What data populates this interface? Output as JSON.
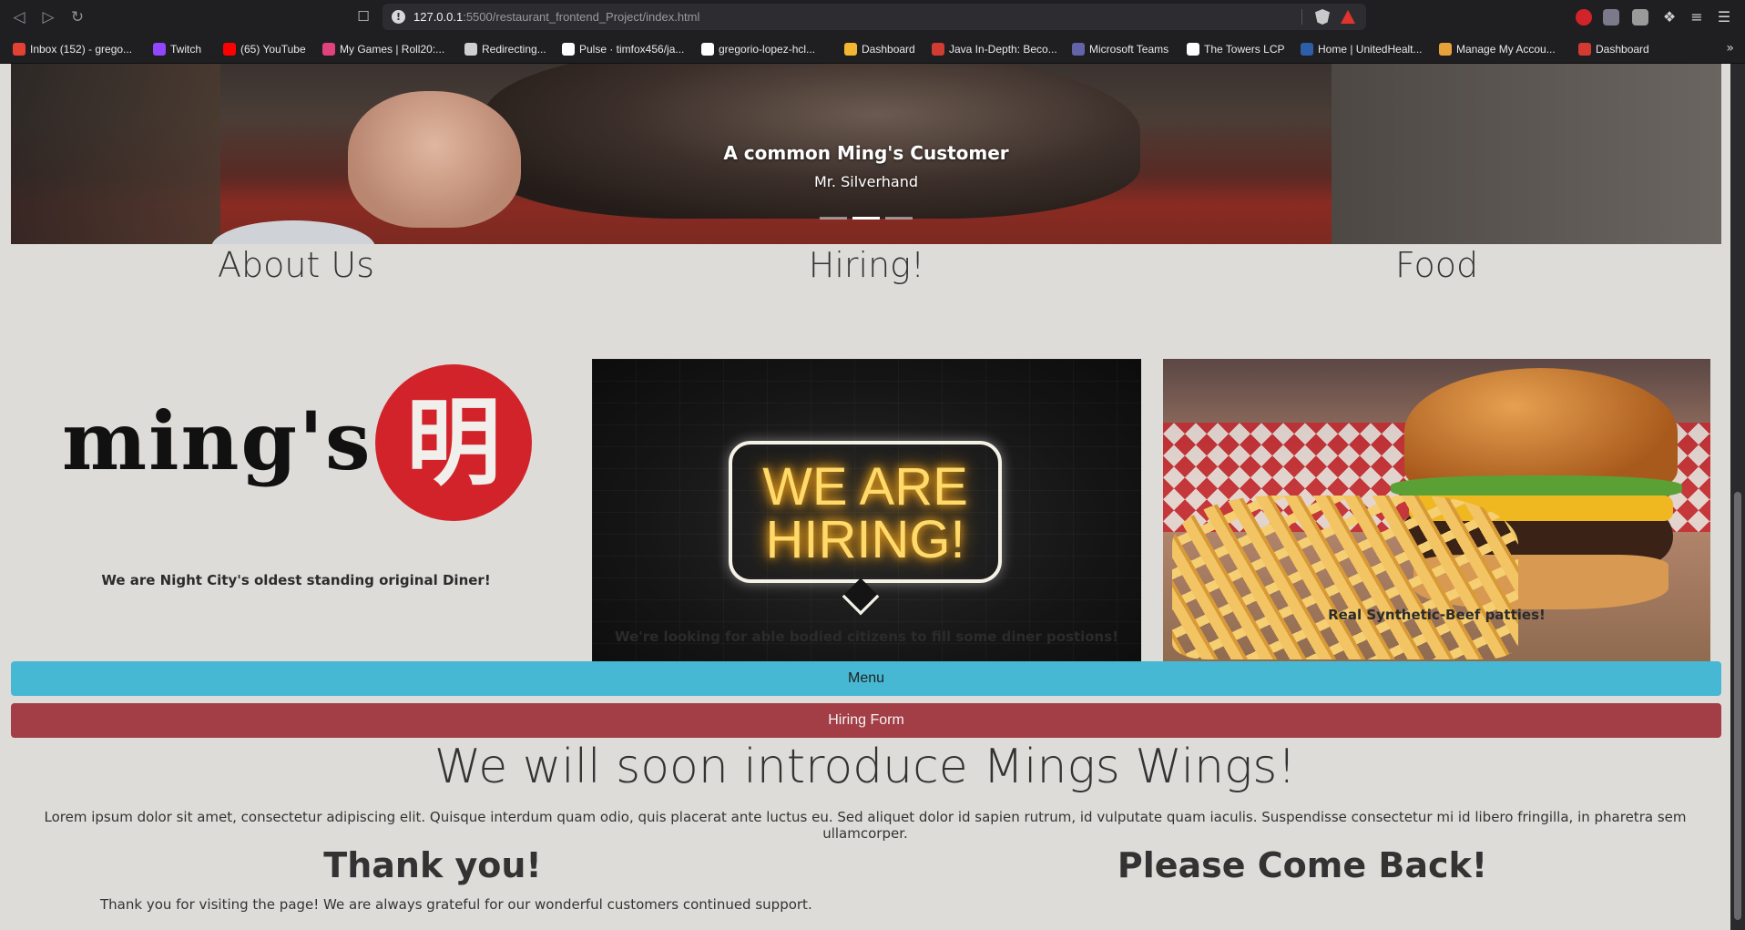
{
  "browser": {
    "url_host": "127.0.0.1",
    "url_rest": ":5500/restaurant_frontend_Project/index.html",
    "bookmarks": [
      {
        "label": "Inbox (152) - grego...",
        "icon_color": "#e34133"
      },
      {
        "label": "Twitch",
        "icon_color": "#9146ff"
      },
      {
        "label": "(65) YouTube",
        "icon_color": "#ff0000"
      },
      {
        "label": "My Games | Roll20:...",
        "icon_color": "#e0427b"
      },
      {
        "label": "Redirecting...",
        "icon_color": "#cfcfcf"
      },
      {
        "label": "Pulse · timfox456/ja...",
        "icon_color": "#ffffff"
      },
      {
        "label": "gregorio-lopez-hcl...",
        "icon_color": "#ffffff"
      },
      {
        "label": "Dashboard",
        "icon_color": "#f2b632"
      },
      {
        "label": "Java In-Depth: Beco...",
        "icon_color": "#d03c31"
      },
      {
        "label": "Microsoft Teams",
        "icon_color": "#6264a7"
      },
      {
        "label": "The Towers LCP",
        "icon_color": "#ffffff"
      },
      {
        "label": "Home | UnitedHealt...",
        "icon_color": "#2f5ea9"
      },
      {
        "label": "Manage My Accou...",
        "icon_color": "#e8a23a"
      },
      {
        "label": "Dashboard",
        "icon_color": "#d43a30"
      }
    ]
  },
  "carousel": {
    "title": "A common Ming's Customer",
    "subtitle": "Mr. Silverhand",
    "active_slide": 2,
    "slide_count": 3
  },
  "columns": {
    "about": {
      "heading": "About Us",
      "caption": "We are Night City's oldest standing original Diner!",
      "logo_word": "ming's",
      "logo_seal": "明"
    },
    "hiring": {
      "heading": "Hiring!",
      "caption": "We're looking for able bodied citizens to fill some diner postions!",
      "neon_line1": "WE ARE",
      "neon_line2": "HIRING!"
    },
    "food": {
      "heading": "Food",
      "caption": "Real Synthetic-Beef patties!"
    }
  },
  "buttons": {
    "menu": "Menu",
    "hiring_form": "Hiring Form",
    "menu_color": "#46b8d4",
    "hiring_color": "#a33d46"
  },
  "promo": {
    "heading": "We will soon introduce Mings Wings!",
    "text": "Lorem ipsum dolor sit amet, consectetur adipiscing elit. Quisque interdum quam odio, quis placerat ante luctus eu. Sed aliquet dolor id sapien rutrum, id vulputate quam iaculis. Suspendisse consectetur mi id libero fringilla, in pharetra sem ullamcorper."
  },
  "footer": {
    "thanks_heading": "Thank you!",
    "thanks_text": "Thank you for visiting the page! We are always grateful for our wonderful customers continued support.",
    "come_back": "Please Come Back!"
  }
}
